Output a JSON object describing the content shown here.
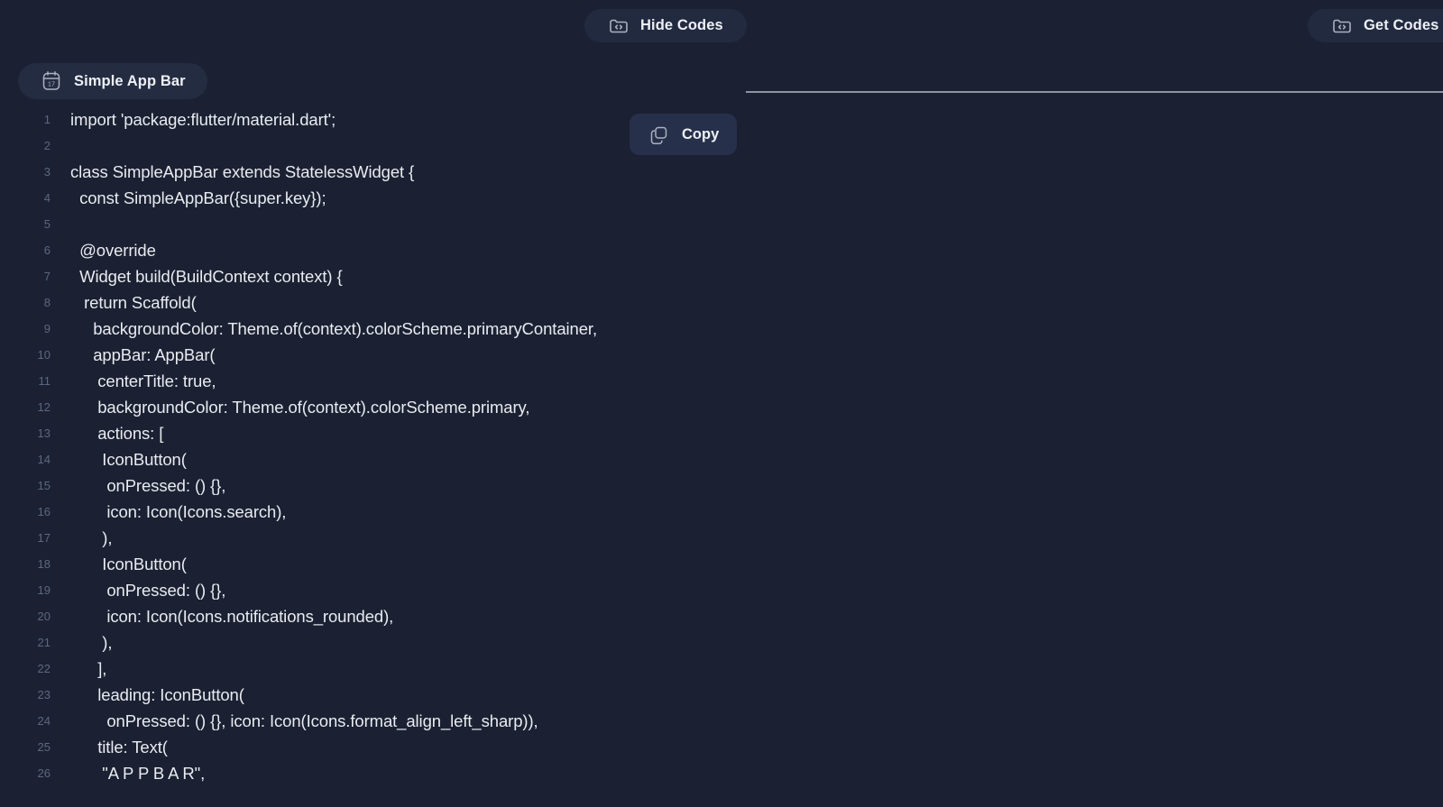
{
  "theme": {
    "background": "#1b2132",
    "pill_background": "#222a40",
    "tab_background": "#242c42",
    "copy_background": "#27304a",
    "text_primary": "#e9ebf1",
    "line_number": "#5d6780",
    "icon_stroke": "#aab0bf",
    "divider": "#8e93a0"
  },
  "toolbar": {
    "hide_codes": {
      "label": "Hide Codes",
      "icon": "folder-code-icon"
    },
    "get_codes": {
      "label": "Get Codes",
      "icon": "folder-code-icon"
    }
  },
  "tab": {
    "label": "Simple App Bar",
    "icon": "calendar-17-icon"
  },
  "copy": {
    "label": "Copy",
    "icon": "copy-icon"
  },
  "code": {
    "language": "dart",
    "lines": [
      {
        "n": "1",
        "text": "import 'package:flutter/material.dart';"
      },
      {
        "n": "2",
        "text": ""
      },
      {
        "n": "3",
        "text": "class SimpleAppBar extends StatelessWidget {"
      },
      {
        "n": "4",
        "text": "  const SimpleAppBar({super.key});"
      },
      {
        "n": "5",
        "text": ""
      },
      {
        "n": "6",
        "text": "  @override"
      },
      {
        "n": "7",
        "text": "  Widget build(BuildContext context) {"
      },
      {
        "n": "8",
        "text": "   return Scaffold("
      },
      {
        "n": "9",
        "text": "     backgroundColor: Theme.of(context).colorScheme.primaryContainer,"
      },
      {
        "n": "10",
        "text": "     appBar: AppBar("
      },
      {
        "n": "11",
        "text": "      centerTitle: true,"
      },
      {
        "n": "12",
        "text": "      backgroundColor: Theme.of(context).colorScheme.primary,"
      },
      {
        "n": "13",
        "text": "      actions: ["
      },
      {
        "n": "14",
        "text": "       IconButton("
      },
      {
        "n": "15",
        "text": "        onPressed: () {},"
      },
      {
        "n": "16",
        "text": "        icon: Icon(Icons.search),"
      },
      {
        "n": "17",
        "text": "       ),"
      },
      {
        "n": "18",
        "text": "       IconButton("
      },
      {
        "n": "19",
        "text": "        onPressed: () {},"
      },
      {
        "n": "20",
        "text": "        icon: Icon(Icons.notifications_rounded),"
      },
      {
        "n": "21",
        "text": "       ),"
      },
      {
        "n": "22",
        "text": "      ],"
      },
      {
        "n": "23",
        "text": "      leading: IconButton("
      },
      {
        "n": "24",
        "text": "        onPressed: () {}, icon: Icon(Icons.format_align_left_sharp)),"
      },
      {
        "n": "25",
        "text": "      title: Text("
      },
      {
        "n": "26",
        "text": "       \"A P P B A R\","
      }
    ]
  }
}
